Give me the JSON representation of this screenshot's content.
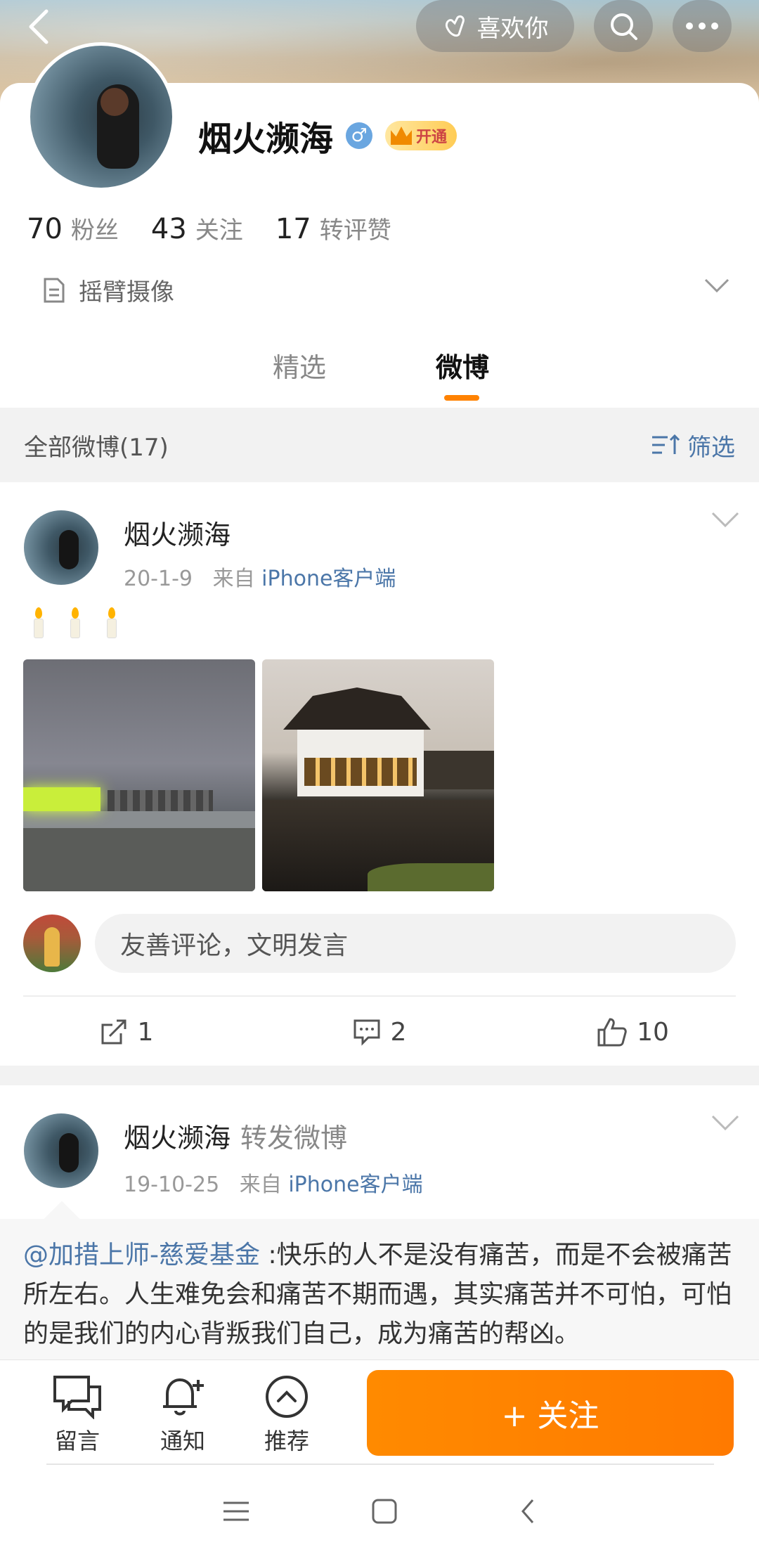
{
  "header": {
    "like_label": "喜欢你"
  },
  "profile": {
    "name": "烟火濒海",
    "gender_symbol": "♂",
    "vip_label": "开通",
    "stats": [
      {
        "num": "70",
        "label": "粉丝"
      },
      {
        "num": "43",
        "label": "关注"
      },
      {
        "num": "17",
        "label": "转评赞"
      }
    ],
    "bio": "摇臂摄像"
  },
  "tabs": {
    "featured": "精选",
    "weibo": "微博"
  },
  "filter": {
    "all_label": "全部微博(17)",
    "filter_label": "筛选"
  },
  "post1": {
    "name": "烟火濒海",
    "date": "20-1-9",
    "from_label": "来自",
    "source": "iPhone客户端",
    "comment_placeholder": "友善评论，文明发言",
    "reposts": "1",
    "comments": "2",
    "likes": "10"
  },
  "post2": {
    "name": "烟火濒海",
    "repost_tag": "转发微博",
    "date": "19-10-25",
    "from_label": "来自",
    "source": "iPhone客户端",
    "mention": "@加措上师-慈爱基金",
    "quote": " :快乐的人不是没有痛苦，而是不会被痛苦所左右。人生难免会和痛苦不期而遇，其实痛苦并不可怕，可怕的是我们的内心背叛我们自己，成为痛苦的帮凶。"
  },
  "bottom": {
    "message": "留言",
    "notify": "通知",
    "recommend": "推荐",
    "follow": "+ 关注"
  },
  "colors": {
    "accent_orange": "#ff8200",
    "link_blue": "#4b76a8"
  },
  "icons": [
    "back-arrow-icon",
    "heart-hand-icon",
    "search-icon",
    "more-icon",
    "document-icon",
    "chevron-down-icon",
    "filter-icon",
    "repost-icon",
    "comment-icon",
    "like-icon",
    "message-icon",
    "bell-icon",
    "recommend-icon",
    "menu-icon",
    "home-icon",
    "back-nav-icon"
  ]
}
